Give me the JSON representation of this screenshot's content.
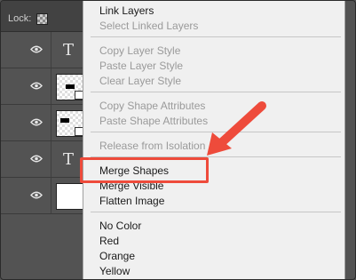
{
  "layers_panel": {
    "lock_label": "Lock:",
    "layers": [
      {
        "kind": "type",
        "glyph": "T"
      },
      {
        "kind": "shape"
      },
      {
        "kind": "shape"
      },
      {
        "kind": "type",
        "glyph": "T"
      },
      {
        "kind": "fill"
      }
    ]
  },
  "context_menu": {
    "groups": [
      [
        {
          "label": "Link Layers",
          "enabled": true
        },
        {
          "label": "Select Linked Layers",
          "enabled": false
        }
      ],
      [
        {
          "label": "Copy Layer Style",
          "enabled": false
        },
        {
          "label": "Paste Layer Style",
          "enabled": false
        },
        {
          "label": "Clear Layer Style",
          "enabled": false
        }
      ],
      [
        {
          "label": "Copy Shape Attributes",
          "enabled": false
        },
        {
          "label": "Paste Shape Attributes",
          "enabled": false
        }
      ],
      [
        {
          "label": "Release from Isolation",
          "enabled": false
        }
      ],
      [
        {
          "label": "Merge Shapes",
          "enabled": true
        },
        {
          "label": "Merge Visible",
          "enabled": true
        },
        {
          "label": "Flatten Image",
          "enabled": true
        }
      ],
      [
        {
          "label": "No Color",
          "enabled": true
        },
        {
          "label": "Red",
          "enabled": true
        },
        {
          "label": "Orange",
          "enabled": true
        },
        {
          "label": "Yellow",
          "enabled": true
        }
      ]
    ]
  },
  "annotation": {
    "highlighted_item": "Merge Shapes",
    "color": "#ee4b3b"
  }
}
